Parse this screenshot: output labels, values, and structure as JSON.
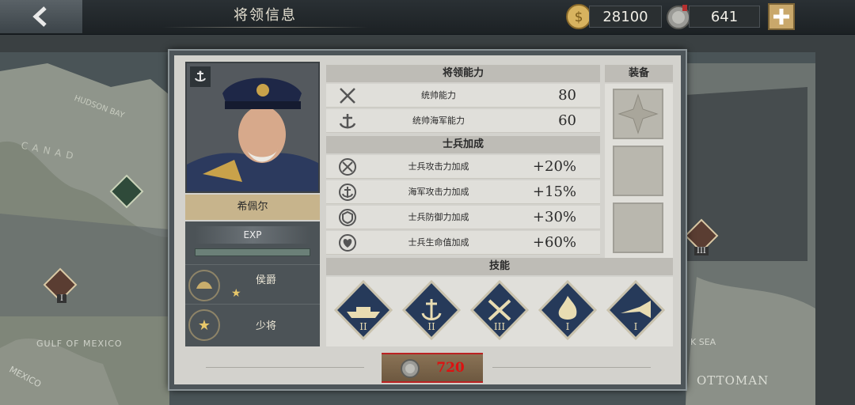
{
  "header": {
    "title": "将领信息"
  },
  "currency": {
    "gold": "28100",
    "medals": "641"
  },
  "general": {
    "name": "希佩尔"
  },
  "exp": {
    "label": "EXP",
    "progress": 0.0
  },
  "ranks": [
    {
      "title": "侯爵",
      "stars": 1
    },
    {
      "title": "少将",
      "stars": 0
    }
  ],
  "sections": {
    "ability": "将领能力",
    "equipment": "装备",
    "soldier_bonus": "士兵加成",
    "skills": "技能"
  },
  "abilities": [
    {
      "icon": "crossed-swords-icon",
      "label": "统帅能力",
      "value": "80"
    },
    {
      "icon": "anchor-icon",
      "label": "统帅海军能力",
      "value": "60"
    }
  ],
  "bonuses": [
    {
      "icon": "attack-bonus-icon",
      "label": "士兵攻击力加成",
      "value": "+20%"
    },
    {
      "icon": "naval-attack-bonus-icon",
      "label": "海军攻击力加成",
      "value": "+15%"
    },
    {
      "icon": "defense-bonus-icon",
      "label": "士兵防御力加成",
      "value": "+30%"
    },
    {
      "icon": "health-bonus-icon",
      "label": "士兵生命值加成",
      "value": "+60%"
    }
  ],
  "skills": [
    {
      "icon": "warship-icon",
      "level": "II"
    },
    {
      "icon": "anchor-laurel-icon",
      "level": "II"
    },
    {
      "icon": "tools-icon",
      "level": "III"
    },
    {
      "icon": "fire-icon",
      "level": "I"
    },
    {
      "icon": "bugle-icon",
      "level": "I"
    }
  ],
  "cost": {
    "value": "720"
  },
  "map_labels": {
    "hudson": "HUDSON BAY",
    "canada": "CANAD",
    "gulf": "GULF OF MEXICO",
    "mexico": "MEXICO",
    "ottoman": "OTTOMAN",
    "sea": "K SEA",
    "unit_left": "I",
    "unit_right": "III"
  },
  "colors": {
    "gold": "#c9a86b",
    "cost_red": "#d11111",
    "skill_blue": "#263a5a"
  }
}
